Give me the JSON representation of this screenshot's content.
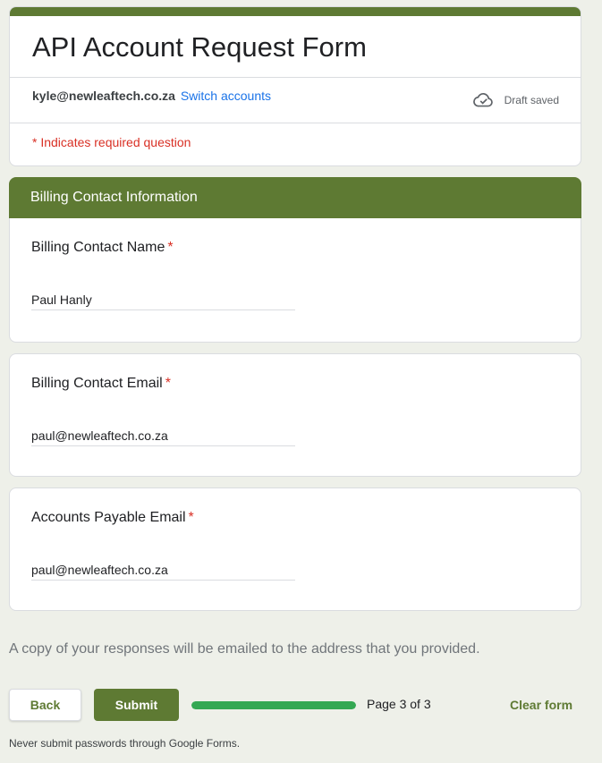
{
  "form": {
    "title": "API Account Request Form",
    "account_email": "kyle@newleaftech.co.za",
    "switch_accounts_label": "Switch accounts",
    "draft_status": "Draft saved",
    "required_note": "* Indicates required question"
  },
  "section": {
    "title": "Billing Contact Information"
  },
  "questions": [
    {
      "label": "Billing Contact Name",
      "required_mark": "*",
      "value": "Paul Hanly"
    },
    {
      "label": "Billing Contact Email",
      "required_mark": "*",
      "value": "paul@newleaftech.co.za"
    },
    {
      "label": "Accounts Payable Email",
      "required_mark": "*",
      "value": "paul@newleaftech.co.za"
    }
  ],
  "copy_note": "A copy of your responses will be emailed to the address that you provided.",
  "footer": {
    "back_label": "Back",
    "submit_label": "Submit",
    "progress_fraction": 1.0,
    "page_indicator": "Page 3 of 3",
    "clear_form_label": "Clear form",
    "password_note": "Never submit passwords through Google Forms."
  },
  "colors": {
    "accent": "#5e7a33",
    "progress": "#34a853",
    "required": "#d93025",
    "link": "#1a73e8"
  }
}
